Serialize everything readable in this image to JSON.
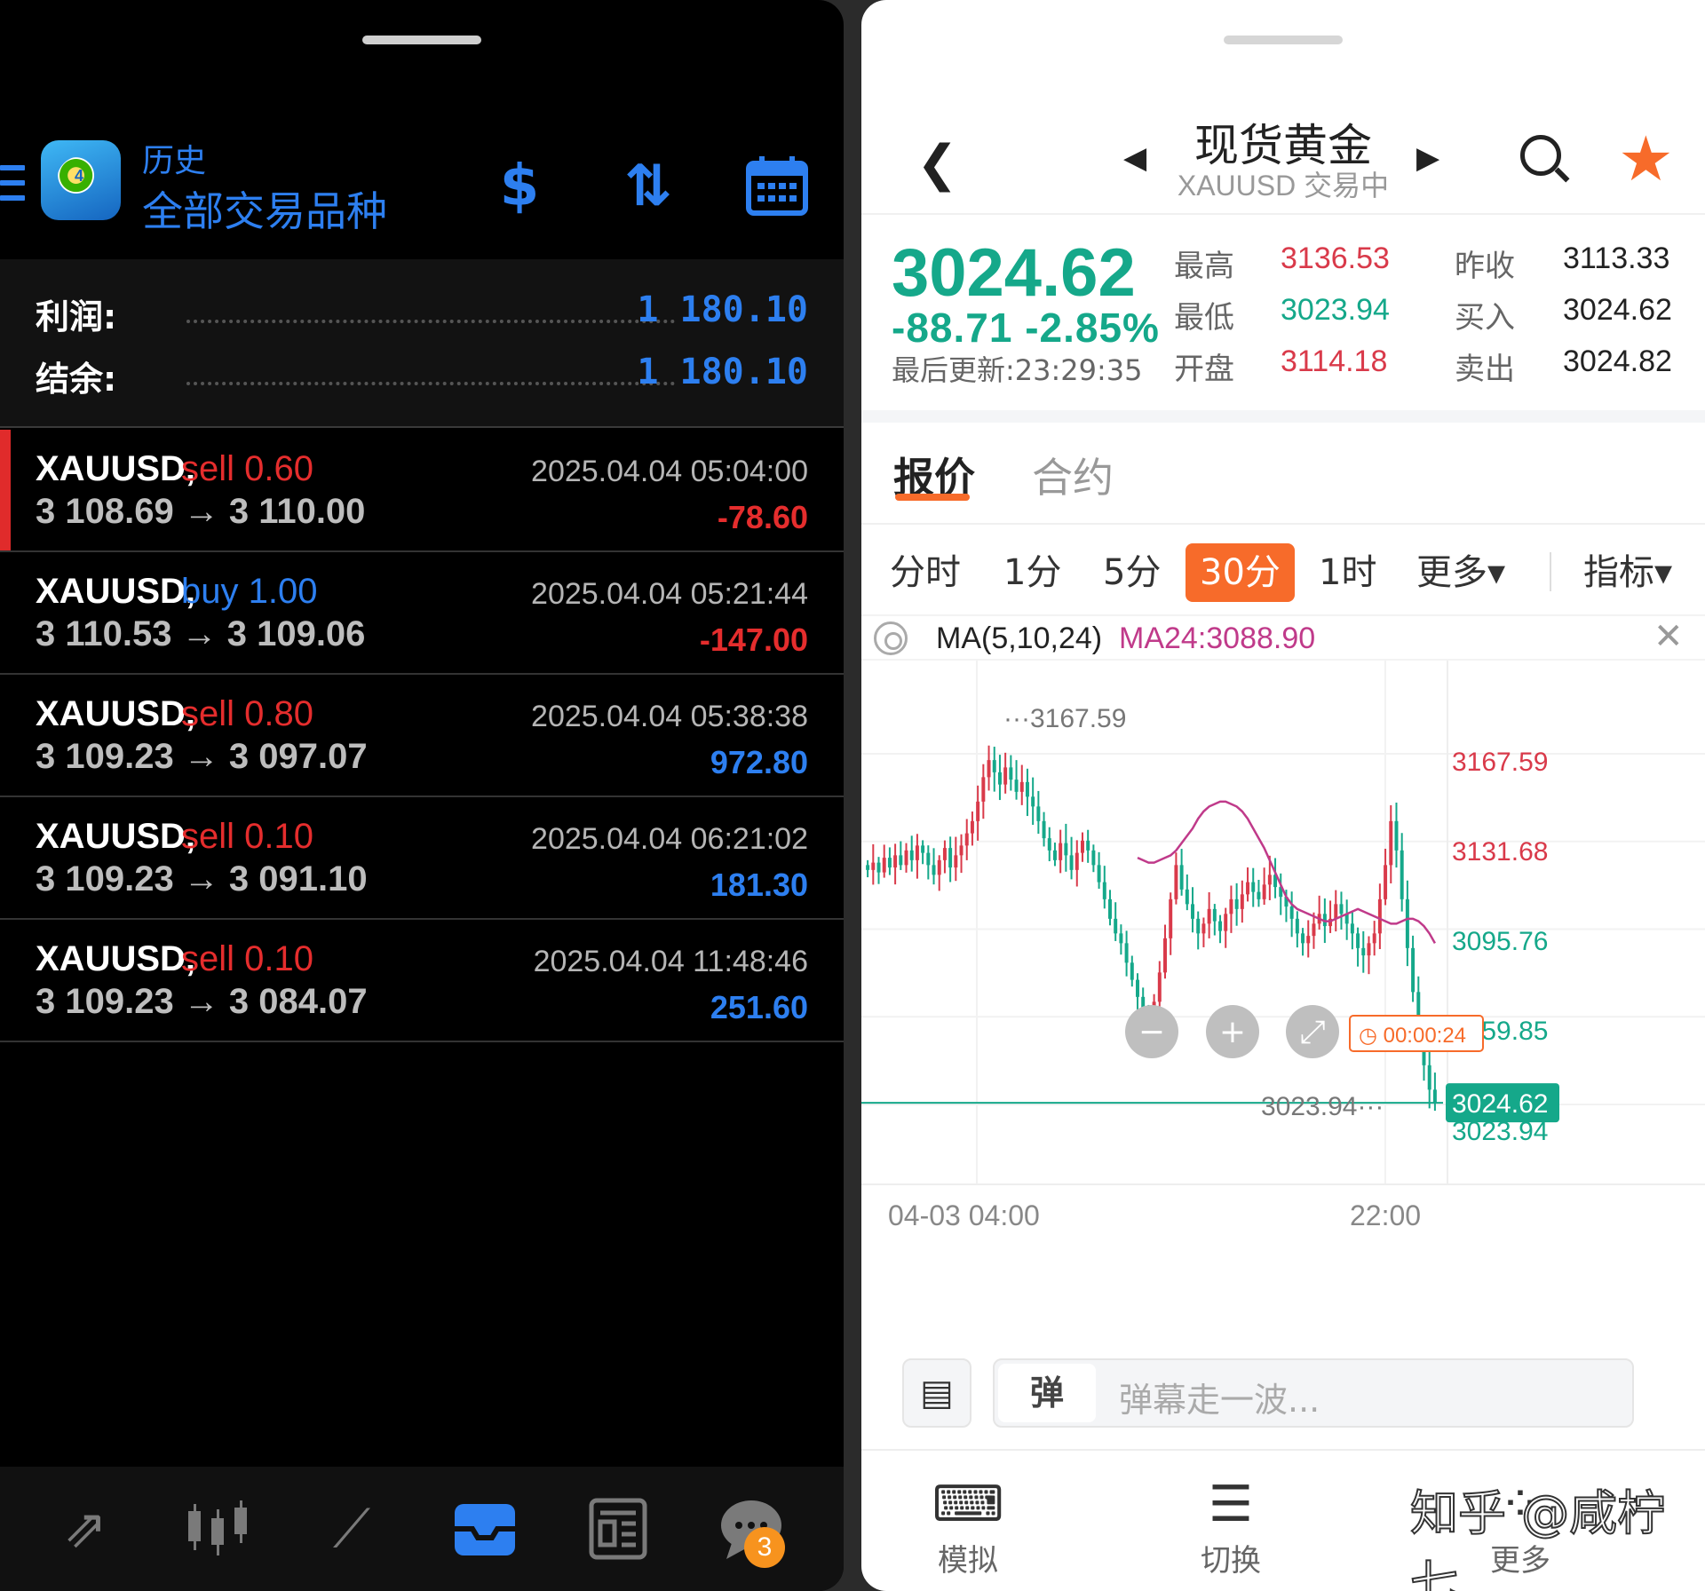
{
  "left": {
    "title_sub": "历史",
    "title_main": "全部交易品种",
    "icons": {
      "menu": "menu-icon",
      "logo": "app-logo",
      "currency": "currency-exchange-icon",
      "sort": "sort-icon",
      "calendar": "calendar-icon"
    },
    "summary": {
      "profit_label": "利润:",
      "profit_value": "1 180.10",
      "balance_label": "结余:",
      "balance_value": "1 180.10"
    },
    "orders": [
      {
        "symbol": "XAUUSD,",
        "side": "sell",
        "lot": "0.60",
        "prices": "3 108.69 → 3 110.00",
        "time": "2025.04.04 05:04:00",
        "pnl": "-78.60",
        "pnl_sign": "neg"
      },
      {
        "symbol": "XAUUSD,",
        "side": "buy",
        "lot": "1.00",
        "prices": "3 110.53 → 3 109.06",
        "time": "2025.04.04 05:21:44",
        "pnl": "-147.00",
        "pnl_sign": "neg"
      },
      {
        "symbol": "XAUUSD,",
        "side": "sell",
        "lot": "0.80",
        "prices": "3 109.23 → 3 097.07",
        "time": "2025.04.04 05:38:38",
        "pnl": "972.80",
        "pnl_sign": "pos"
      },
      {
        "symbol": "XAUUSD,",
        "side": "sell",
        "lot": "0.10",
        "prices": "3 109.23 → 3 091.10",
        "time": "2025.04.04 06:21:02",
        "pnl": "181.30",
        "pnl_sign": "pos"
      },
      {
        "symbol": "XAUUSD,",
        "side": "sell",
        "lot": "0.10",
        "prices": "3 109.23 → 3 084.07",
        "time": "2025.04.04 11:48:46",
        "pnl": "251.60",
        "pnl_sign": "pos"
      }
    ],
    "bottom_nav": {
      "items": [
        "trade-icon",
        "quotes-icon",
        "chart-icon",
        "history-icon",
        "news-icon",
        "chat-icon"
      ],
      "active": "history-icon",
      "chat_badge": "3"
    }
  },
  "right": {
    "title": "现货黄金",
    "subtitle": "XAUUSD 交易中",
    "last_price": "3024.62",
    "change": "-88.71  -2.85%",
    "updated": "最后更新:23:29:35",
    "stats": {
      "high_label": "最高",
      "high": "3136.53",
      "low_label": "最低",
      "low": "3023.94",
      "open_label": "开盘",
      "open": "3114.18",
      "prev_close_label": "昨收",
      "prev_close": "3113.33",
      "bid_label": "买入",
      "bid": "3024.62",
      "ask_label": "卖出",
      "ask": "3024.82"
    },
    "tabs": {
      "quote": "报价",
      "contract": "合约"
    },
    "periods": [
      "分时",
      "1分",
      "5分",
      "30分",
      "1时",
      "更多▾",
      "指标▾"
    ],
    "selected_period": "30分",
    "indicator": {
      "name": "MA(5,10,24)",
      "value": "MA24:3088.90"
    },
    "colors": {
      "up": "#d93a4a",
      "down": "#15a88a",
      "accent": "#f76b2a",
      "ma": "#c03a8a"
    },
    "danmu": {
      "toggle": "弹",
      "placeholder": "弹幕走一波..."
    },
    "bottom": {
      "sim": "模拟",
      "switch": "切换",
      "more": "更多"
    },
    "watermark": "知乎 @咸柠七"
  },
  "chart_data": {
    "type": "candlestick",
    "symbol": "XAUUSD",
    "interval": "30分",
    "y_ticks": [
      "3167.59",
      "3131.68",
      "3095.76",
      "3059.85",
      "3023.94"
    ],
    "ylim": [
      3023.94,
      3167.59
    ],
    "x_ticks": [
      "04-03 04:00",
      "22:00"
    ],
    "high_marker": "3167.59",
    "low_marker": "3023.94",
    "current_price": "3024.62",
    "countdown": "00:00:24",
    "zoom_controls": [
      "zoom-out",
      "zoom-in",
      "fullscreen"
    ],
    "close_series": [
      3120,
      3123,
      3119,
      3125,
      3121,
      3126,
      3122,
      3128,
      3124,
      3130,
      3127,
      3122,
      3118,
      3124,
      3129,
      3121,
      3126,
      3130,
      3135,
      3140,
      3148,
      3158,
      3165,
      3160,
      3155,
      3162,
      3157,
      3152,
      3156,
      3150,
      3146,
      3140,
      3133,
      3128,
      3124,
      3131,
      3126,
      3120,
      3127,
      3132,
      3128,
      3122,
      3115,
      3108,
      3100,
      3094,
      3090,
      3082,
      3075,
      3068,
      3062,
      3060,
      3066,
      3078,
      3092,
      3108,
      3122,
      3112,
      3106,
      3100,
      3094,
      3098,
      3104,
      3099,
      3095,
      3102,
      3108,
      3104,
      3110,
      3115,
      3111,
      3108,
      3114,
      3118,
      3113,
      3109,
      3105,
      3100,
      3094,
      3090,
      3093,
      3098,
      3102,
      3097,
      3100,
      3106,
      3102,
      3098,
      3094,
      3088,
      3085,
      3090,
      3094,
      3108,
      3122,
      3140,
      3128,
      3108,
      3088,
      3070,
      3052,
      3040,
      3030,
      3024.62
    ],
    "ma24_series": [
      3125,
      3124,
      3123,
      3123,
      3124,
      3125,
      3126,
      3128,
      3131,
      3134,
      3137,
      3141,
      3144,
      3146,
      3147,
      3148,
      3148,
      3147,
      3146,
      3144,
      3141,
      3137,
      3133,
      3129,
      3124,
      3119,
      3114,
      3109,
      3106,
      3104,
      3103,
      3102,
      3101,
      3100,
      3099,
      3099,
      3100,
      3101,
      3102,
      3103,
      3104,
      3103,
      3102,
      3101,
      3100,
      3099,
      3098,
      3098,
      3099,
      3100,
      3100,
      3099,
      3097,
      3094,
      3090
    ]
  }
}
